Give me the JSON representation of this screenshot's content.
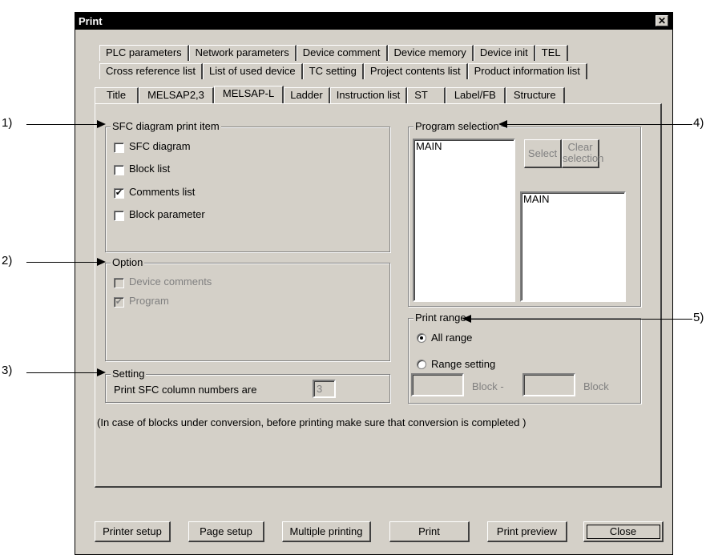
{
  "dialog": {
    "title": "Print",
    "close_glyph": "✕"
  },
  "tabs": {
    "row1": [
      "PLC parameters",
      "Network parameters",
      "Device comment",
      "Device memory",
      "Device init",
      "TEL"
    ],
    "row2": [
      "Cross reference list",
      "List of used device",
      "TC setting",
      "Project contents list",
      "Product information list"
    ],
    "row3": [
      "Title",
      "MELSAP2,3",
      "MELSAP-L",
      "Ladder",
      "Instruction list",
      "ST",
      "Label/FB",
      "Structure"
    ],
    "active": "MELSAP-L"
  },
  "sfc_group": {
    "label": "SFC diagram print item",
    "items": [
      {
        "label": "SFC diagram",
        "checked": false
      },
      {
        "label": "Block list",
        "checked": false
      },
      {
        "label": "Comments list",
        "checked": true
      },
      {
        "label": "Block parameter",
        "checked": false
      }
    ]
  },
  "option_group": {
    "label": "Option",
    "items": [
      {
        "label": "Device comments",
        "checked": false
      },
      {
        "label": "Program",
        "checked": true
      }
    ]
  },
  "setting_group": {
    "label": "Setting",
    "text": "Print SFC column numbers are",
    "value": "3"
  },
  "program_group": {
    "label": "Program selection",
    "left_list": [
      "MAIN"
    ],
    "right_list": [
      "MAIN"
    ],
    "select_label": "Select",
    "clear_label_1": "Clear",
    "clear_label_2": "selection"
  },
  "range_group": {
    "label": "Print range",
    "all_label": "All range",
    "range_label": "Range setting",
    "block_label_1": "Block  -",
    "block_label_2": "Block",
    "selected": "All range"
  },
  "note": "(In case of blocks under conversion, before printing make sure that conversion is completed )",
  "buttons": {
    "printer_setup": "Printer setup",
    "page_setup": "Page setup",
    "multiple_printing": "Multiple printing",
    "print": "Print",
    "print_preview": "Print preview",
    "close": "Close"
  },
  "callouts": {
    "c1": "1)",
    "c2": "2)",
    "c3": "3)",
    "c4": "4)",
    "c5": "5)"
  }
}
